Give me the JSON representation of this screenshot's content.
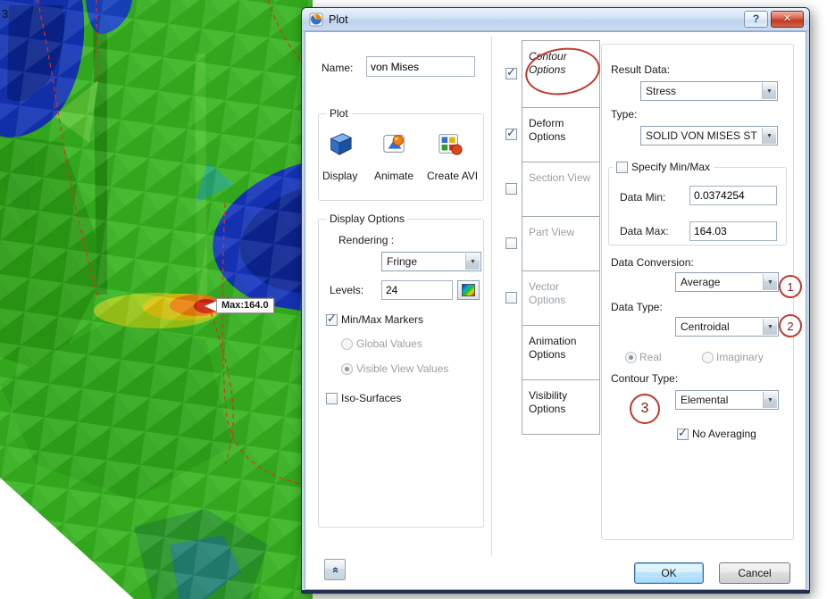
{
  "icons": {
    "check": "✓",
    "dropdown_arrow": "▼",
    "help": "?",
    "close": "✕",
    "expand": "»"
  },
  "colors": {
    "annotation_red": "#c0392b",
    "mesh_green": "#36b41e",
    "mesh_blue": "#1433b8",
    "mesh_red": "#d42408",
    "mesh_orange": "#e8820c",
    "mesh_yellow": "#d8c50e"
  },
  "viewport": {
    "corner_label": "3",
    "max_label": "Max:164.0"
  },
  "window": {
    "title": "Plot"
  },
  "left": {
    "name_label": "Name:",
    "name_value": "von Mises",
    "plot_group": {
      "title": "Plot",
      "buttons": [
        {
          "label": "Display"
        },
        {
          "label": "Animate"
        },
        {
          "label": "Create AVI"
        }
      ]
    },
    "display_options": {
      "title": "Display Options",
      "rendering_label": "Rendering :",
      "rendering_value": "Fringe",
      "levels_label": "Levels:",
      "levels_value": "24",
      "minmax_markers_label": "Min/Max Markers",
      "minmax_markers_checked": true,
      "global_values_label": "Global Values",
      "global_values_selected": false,
      "visible_view_values_label": "Visible View Values",
      "visible_view_values_selected": true,
      "iso_surfaces_label": "Iso-Surfaces",
      "iso_surfaces_checked": false
    }
  },
  "tabs": [
    {
      "label": "Contour Options",
      "checked": true,
      "enabled": true,
      "active": true
    },
    {
      "label": "Deform Options",
      "checked": true,
      "enabled": true
    },
    {
      "label": "Section View",
      "checked": false,
      "enabled": false
    },
    {
      "label": "Part View",
      "checked": false,
      "enabled": false
    },
    {
      "label": "Vector Options",
      "checked": false,
      "enabled": false
    },
    {
      "label": "Animation Options",
      "enabled": true
    },
    {
      "label": "Visibility Options",
      "enabled": true
    }
  ],
  "contour_panel": {
    "result_data_label": "Result Data:",
    "result_data_value": "Stress",
    "type_label": "Type:",
    "type_value": "SOLID VON MISES ST",
    "specify_minmax_label": "Specify Min/Max",
    "specify_minmax_checked": false,
    "data_min_label": "Data Min:",
    "data_min_value": "0.0374254",
    "data_max_label": "Data Max:",
    "data_max_value": "164.03",
    "data_conversion_label": "Data Conversion:",
    "data_conversion_value": "Average",
    "data_type_label": "Data Type:",
    "data_type_value": "Centroidal",
    "real_label": "Real",
    "real_selected": true,
    "imaginary_label": "Imaginary",
    "imaginary_selected": false,
    "contour_type_label": "Contour Type:",
    "contour_type_value": "Elemental",
    "no_averaging_label": "No Averaging",
    "no_averaging_checked": true
  },
  "annotations": {
    "circle1": "1",
    "circle2": "2",
    "circle3": "3"
  },
  "footer": {
    "ok_label": "OK",
    "cancel_label": "Cancel"
  }
}
